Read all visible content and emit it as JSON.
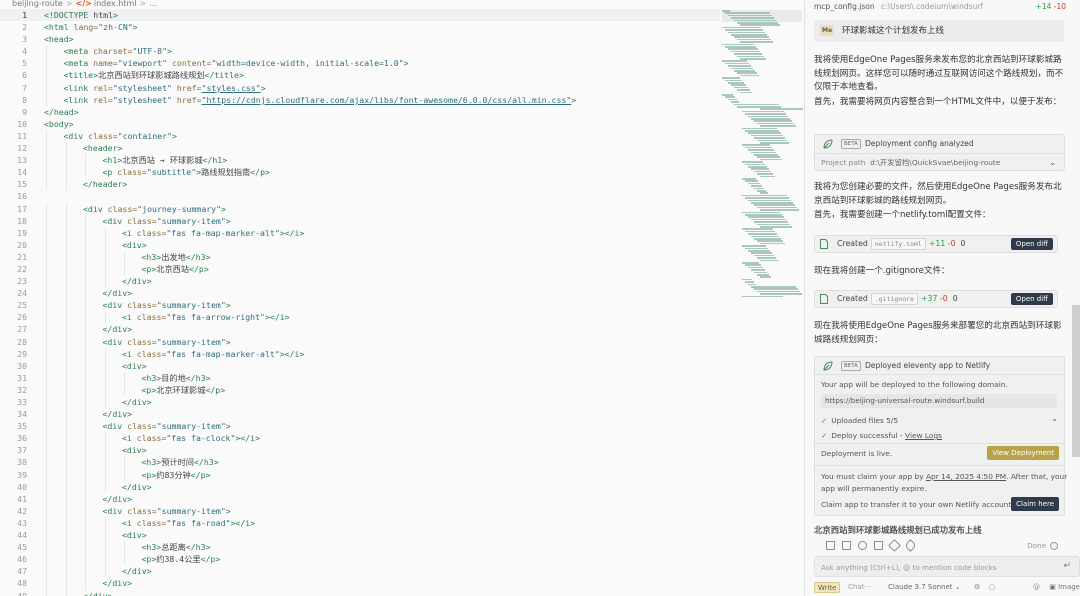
{
  "breadcrumb": {
    "folder": "beijing-route",
    "file": "index.html",
    "more": "..."
  },
  "code_lines": [
    {
      "n": 1,
      "indent": 0,
      "parts": [
        [
          "doc",
          "<!DOCTYPE"
        ],
        [
          "txt",
          " html"
        ],
        [
          "doc",
          ">"
        ]
      ]
    },
    {
      "n": 2,
      "indent": 0,
      "parts": [
        [
          "tag",
          "<html"
        ],
        [
          "attr",
          " lang="
        ],
        [
          "val",
          "\"zh-CN\""
        ],
        [
          "tag",
          ">"
        ]
      ]
    },
    {
      "n": 3,
      "indent": 0,
      "parts": [
        [
          "tag",
          "<head>"
        ]
      ]
    },
    {
      "n": 4,
      "indent": 1,
      "parts": [
        [
          "tag",
          "<meta"
        ],
        [
          "attr",
          " charset="
        ],
        [
          "val",
          "\"UTF-8\""
        ],
        [
          "tag",
          ">"
        ]
      ]
    },
    {
      "n": 5,
      "indent": 1,
      "parts": [
        [
          "tag",
          "<meta"
        ],
        [
          "attr",
          " name="
        ],
        [
          "val",
          "\"viewport\""
        ],
        [
          "attr",
          " content="
        ],
        [
          "val",
          "\"width=device-width, initial-scale=1.0\""
        ],
        [
          "tag",
          ">"
        ]
      ]
    },
    {
      "n": 6,
      "indent": 1,
      "parts": [
        [
          "tag",
          "<title>"
        ],
        [
          "txt",
          "北京西站到环球影城路线规划"
        ],
        [
          "tag",
          "</title>"
        ]
      ]
    },
    {
      "n": 7,
      "indent": 1,
      "parts": [
        [
          "tag",
          "<link"
        ],
        [
          "attr",
          " rel="
        ],
        [
          "val",
          "\"stylesheet\""
        ],
        [
          "attr",
          " href="
        ],
        [
          "str",
          "\"styles.css\""
        ],
        [
          "tag",
          ">"
        ]
      ]
    },
    {
      "n": 8,
      "indent": 1,
      "parts": [
        [
          "tag",
          "<link"
        ],
        [
          "attr",
          " rel="
        ],
        [
          "val",
          "\"stylesheet\""
        ],
        [
          "attr",
          " href="
        ],
        [
          "str",
          "\"https://cdnjs.cloudflare.com/ajax/libs/font-awesome/6.0.0/css/all.min.css\""
        ],
        [
          "tag",
          ">"
        ]
      ]
    },
    {
      "n": 9,
      "indent": 0,
      "parts": [
        [
          "tag",
          "</head>"
        ]
      ]
    },
    {
      "n": 10,
      "indent": 0,
      "parts": [
        [
          "tag",
          "<body>"
        ]
      ]
    },
    {
      "n": 11,
      "indent": 1,
      "parts": [
        [
          "tag",
          "<div"
        ],
        [
          "attr",
          " class="
        ],
        [
          "val",
          "\"container\""
        ],
        [
          "tag",
          ">"
        ]
      ]
    },
    {
      "n": 12,
      "indent": 2,
      "parts": [
        [
          "tag",
          "<header>"
        ]
      ]
    },
    {
      "n": 13,
      "indent": 3,
      "parts": [
        [
          "tag",
          "<h1>"
        ],
        [
          "txt",
          "北京西站 → 环球影城"
        ],
        [
          "tag",
          "</h1>"
        ]
      ]
    },
    {
      "n": 14,
      "indent": 3,
      "parts": [
        [
          "tag",
          "<p"
        ],
        [
          "attr",
          " class="
        ],
        [
          "val",
          "\"subtitle\""
        ],
        [
          "tag",
          ">"
        ],
        [
          "txt",
          "路线规划指南"
        ],
        [
          "tag",
          "</p>"
        ]
      ]
    },
    {
      "n": 15,
      "indent": 2,
      "parts": [
        [
          "tag",
          "</header>"
        ]
      ]
    },
    {
      "n": 16,
      "indent": 0,
      "parts": []
    },
    {
      "n": 17,
      "indent": 2,
      "parts": [
        [
          "tag",
          "<div"
        ],
        [
          "attr",
          " class="
        ],
        [
          "val",
          "\"journey-summary\""
        ],
        [
          "tag",
          ">"
        ]
      ]
    },
    {
      "n": 18,
      "indent": 3,
      "parts": [
        [
          "tag",
          "<div"
        ],
        [
          "attr",
          " class="
        ],
        [
          "val",
          "\"summary-item\""
        ],
        [
          "tag",
          ">"
        ]
      ]
    },
    {
      "n": 19,
      "indent": 4,
      "parts": [
        [
          "tag",
          "<i"
        ],
        [
          "attr",
          " class="
        ],
        [
          "val",
          "\"fas fa-map-marker-alt\""
        ],
        [
          "tag",
          "></i>"
        ]
      ]
    },
    {
      "n": 20,
      "indent": 4,
      "parts": [
        [
          "tag",
          "<div>"
        ]
      ]
    },
    {
      "n": 21,
      "indent": 5,
      "parts": [
        [
          "tag",
          "<h3>"
        ],
        [
          "txt",
          "出发地"
        ],
        [
          "tag",
          "</h3>"
        ]
      ]
    },
    {
      "n": 22,
      "indent": 5,
      "parts": [
        [
          "tag",
          "<p>"
        ],
        [
          "txt",
          "北京西站"
        ],
        [
          "tag",
          "</p>"
        ]
      ]
    },
    {
      "n": 23,
      "indent": 4,
      "parts": [
        [
          "tag",
          "</div>"
        ]
      ]
    },
    {
      "n": 24,
      "indent": 3,
      "parts": [
        [
          "tag",
          "</div>"
        ]
      ]
    },
    {
      "n": 25,
      "indent": 3,
      "parts": [
        [
          "tag",
          "<div"
        ],
        [
          "attr",
          " class="
        ],
        [
          "val",
          "\"summary-item\""
        ],
        [
          "tag",
          ">"
        ]
      ]
    },
    {
      "n": 26,
      "indent": 4,
      "parts": [
        [
          "tag",
          "<i"
        ],
        [
          "attr",
          " class="
        ],
        [
          "val",
          "\"fas fa-arrow-right\""
        ],
        [
          "tag",
          "></i>"
        ]
      ]
    },
    {
      "n": 27,
      "indent": 3,
      "parts": [
        [
          "tag",
          "</div>"
        ]
      ]
    },
    {
      "n": 28,
      "indent": 3,
      "parts": [
        [
          "tag",
          "<div"
        ],
        [
          "attr",
          " class="
        ],
        [
          "val",
          "\"summary-item\""
        ],
        [
          "tag",
          ">"
        ]
      ]
    },
    {
      "n": 29,
      "indent": 4,
      "parts": [
        [
          "tag",
          "<i"
        ],
        [
          "attr",
          " class="
        ],
        [
          "val",
          "\"fas fa-map-marker-alt\""
        ],
        [
          "tag",
          "></i>"
        ]
      ]
    },
    {
      "n": 30,
      "indent": 4,
      "parts": [
        [
          "tag",
          "<div>"
        ]
      ]
    },
    {
      "n": 31,
      "indent": 5,
      "parts": [
        [
          "tag",
          "<h3>"
        ],
        [
          "txt",
          "目的地"
        ],
        [
          "tag",
          "</h3>"
        ]
      ]
    },
    {
      "n": 32,
      "indent": 5,
      "parts": [
        [
          "tag",
          "<p>"
        ],
        [
          "txt",
          "北京环球影城"
        ],
        [
          "tag",
          "</p>"
        ]
      ]
    },
    {
      "n": 33,
      "indent": 4,
      "parts": [
        [
          "tag",
          "</div>"
        ]
      ]
    },
    {
      "n": 34,
      "indent": 3,
      "parts": [
        [
          "tag",
          "</div>"
        ]
      ]
    },
    {
      "n": 35,
      "indent": 3,
      "parts": [
        [
          "tag",
          "<div"
        ],
        [
          "attr",
          " class="
        ],
        [
          "val",
          "\"summary-item\""
        ],
        [
          "tag",
          ">"
        ]
      ]
    },
    {
      "n": 36,
      "indent": 4,
      "parts": [
        [
          "tag",
          "<i"
        ],
        [
          "attr",
          " class="
        ],
        [
          "val",
          "\"fas fa-clock\""
        ],
        [
          "tag",
          "></i>"
        ]
      ]
    },
    {
      "n": 37,
      "indent": 4,
      "parts": [
        [
          "tag",
          "<div>"
        ]
      ]
    },
    {
      "n": 38,
      "indent": 5,
      "parts": [
        [
          "tag",
          "<h3>"
        ],
        [
          "txt",
          "预计时间"
        ],
        [
          "tag",
          "</h3>"
        ]
      ]
    },
    {
      "n": 39,
      "indent": 5,
      "parts": [
        [
          "tag",
          "<p>"
        ],
        [
          "txt",
          "约83分钟"
        ],
        [
          "tag",
          "</p>"
        ]
      ]
    },
    {
      "n": 40,
      "indent": 4,
      "parts": [
        [
          "tag",
          "</div>"
        ]
      ]
    },
    {
      "n": 41,
      "indent": 3,
      "parts": [
        [
          "tag",
          "</div>"
        ]
      ]
    },
    {
      "n": 42,
      "indent": 3,
      "parts": [
        [
          "tag",
          "<div"
        ],
        [
          "attr",
          " class="
        ],
        [
          "val",
          "\"summary-item\""
        ],
        [
          "tag",
          ">"
        ]
      ]
    },
    {
      "n": 43,
      "indent": 4,
      "parts": [
        [
          "tag",
          "<i"
        ],
        [
          "attr",
          " class="
        ],
        [
          "val",
          "\"fas fa-road\""
        ],
        [
          "tag",
          "></i>"
        ]
      ]
    },
    {
      "n": 44,
      "indent": 4,
      "parts": [
        [
          "tag",
          "<div>"
        ]
      ]
    },
    {
      "n": 45,
      "indent": 5,
      "parts": [
        [
          "tag",
          "<h3>"
        ],
        [
          "txt",
          "总距离"
        ],
        [
          "tag",
          "</h3>"
        ]
      ]
    },
    {
      "n": 46,
      "indent": 5,
      "parts": [
        [
          "tag",
          "<p>"
        ],
        [
          "txt",
          "约38.4公里"
        ],
        [
          "tag",
          "</p>"
        ]
      ]
    },
    {
      "n": 47,
      "indent": 4,
      "parts": [
        [
          "tag",
          "</div>"
        ]
      ]
    },
    {
      "n": 48,
      "indent": 3,
      "parts": [
        [
          "tag",
          "</div>"
        ]
      ]
    },
    {
      "n": 49,
      "indent": 2,
      "parts": [
        [
          "tag",
          "</div>"
        ]
      ]
    }
  ],
  "active_line": 1,
  "chat": {
    "topbar": {
      "file": "mcp_config.json",
      "path": "c:\\Users\\.codeium\\windsurf",
      "additions": "+14",
      "deletions": "-10"
    },
    "user": {
      "avatar": "Me",
      "text": "环球影城这个计划发布上线"
    },
    "p1": "我将使用EdgeOne Pages服务来发布您的北京西站到环球影城路线规划网页。这样您可以随时通过互联网访问这个路线规划，而不仅限于本地查看。",
    "p2": "首先，我需要将网页内容整合到一个HTML文件中，以便于发布：",
    "config_card": {
      "badge": "BETA",
      "title": "Deployment config analyzed",
      "path_label": "Project path",
      "path_value": "d:\\开发留档\\QuickSvae\\beijing-route"
    },
    "p3": "我将为您创建必要的文件，然后使用EdgeOne Pages服务发布北京西站到环球影城的路线规划网页。",
    "p4": "首先，我需要创建一个netlify.toml配置文件：",
    "file1": {
      "created": "Created",
      "name": "netlify.toml",
      "add": "+11",
      "del": "-0",
      "num": "0",
      "button": "Open diff"
    },
    "p5": "现在我将创建一个.gitignore文件：",
    "file2": {
      "created": "Created",
      "name": ".gitignore",
      "add": "+37",
      "del": "-0",
      "num": "0",
      "button": "Open diff"
    },
    "p6": "现在我将使用EdgeOne Pages服务来部署您的北京西站到环球影城路线规划网页：",
    "deploy": {
      "badge": "BETA",
      "title": "Deployed eleventy app to Netlify",
      "intro": "Your app will be deployed to the following domain.",
      "url": "https://beijing-universal-route.windsurf.build",
      "uploaded": "Uploaded files 5/5",
      "success": "Deploy successful - ",
      "view_logs": "View Logs",
      "live": "Deployment is live.",
      "view_btn": "View Deployment",
      "claim_a": "You must claim your app by ",
      "claim_date": "Apr 14, 2025 4:50 PM",
      "claim_b": ". After that, your",
      "claim_c": "app will permanently expire.",
      "claim_d": "Claim app to transfer it to your own Netlify account",
      "claim_btn": "Claim here"
    },
    "summary": "北京西站到环球影城路线规划已成功发布上线",
    "done": "Done",
    "input_placeholder": "Ask anything (Ctrl+L), @ to mention code blocks",
    "bottom": {
      "write": "Write",
      "chat": "Chat",
      "more": "···",
      "model": "Claude 3.7 Sonnet",
      "image": "Image"
    }
  }
}
